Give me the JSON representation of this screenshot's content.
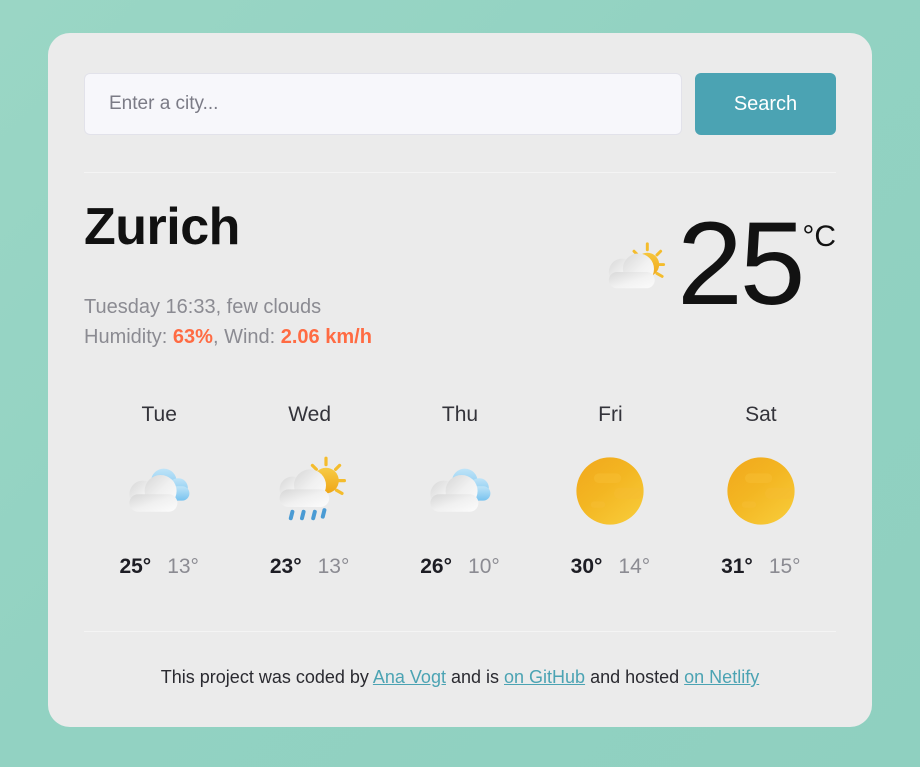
{
  "colors": {
    "page_background": "#92d2c2",
    "card_background": "#ebebeb",
    "accent_teal": "#4ba3b3",
    "accent_orange": "#ff6b43",
    "input_background": "#f7f7fb"
  },
  "search": {
    "placeholder": "Enter a city...",
    "value": "",
    "button_label": "Search"
  },
  "current": {
    "city": "Zurich",
    "datetime_condition": "Tuesday 16:33, few clouds",
    "humidity_label": "Humidity: ",
    "humidity_value": "63%",
    "separator": ", ",
    "wind_label": "Wind: ",
    "wind_value": "2.06 km/h",
    "temperature": "25",
    "unit": "°C",
    "icon": "sun-behind-cloud-icon"
  },
  "forecast": [
    {
      "day": "Tue",
      "icon": "broken-clouds-icon",
      "max": "25°",
      "min": "13°"
    },
    {
      "day": "Wed",
      "icon": "sun-cloud-rain-icon",
      "max": "23°",
      "min": "13°"
    },
    {
      "day": "Thu",
      "icon": "broken-clouds-icon",
      "max": "26°",
      "min": "10°"
    },
    {
      "day": "Fri",
      "icon": "clear-sun-icon",
      "max": "30°",
      "min": "14°"
    },
    {
      "day": "Sat",
      "icon": "clear-sun-icon",
      "max": "31°",
      "min": "15°"
    }
  ],
  "footer": {
    "text_1": "This project was coded by ",
    "link_author": "Ana Vogt",
    "text_2": " and is ",
    "link_github": "on GitHub",
    "text_3": " and hosted ",
    "link_netlify": "on Netlify"
  }
}
